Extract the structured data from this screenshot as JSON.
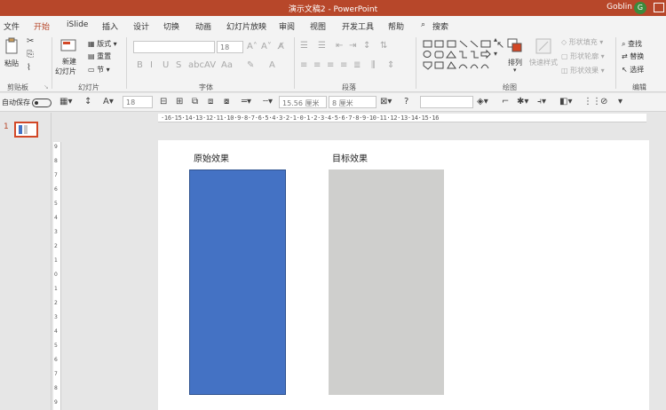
{
  "window": {
    "title": "演示文稿2 - PowerPoint",
    "user": "Goblin",
    "avatar_letter": "G"
  },
  "tabs": [
    "文件",
    "开始",
    "iSlide",
    "插入",
    "设计",
    "切换",
    "动画",
    "幻灯片放映",
    "审阅",
    "视图",
    "开发工具",
    "帮助",
    "搜索"
  ],
  "ribbon": {
    "clipboard": {
      "paste": "粘贴",
      "group": "剪贴板"
    },
    "slides": {
      "new_slide": "新建",
      "new_slide2": "幻灯片",
      "layout": "版式",
      "reset": "重置",
      "section": "节",
      "group": "幻灯片"
    },
    "font": {
      "font_name": "",
      "font_size": "18",
      "group": "字体"
    },
    "paragraph": {
      "group": "段落"
    },
    "drawing": {
      "arrange": "排列",
      "quick_styles": "快速样式",
      "shape_fill": "形状填充",
      "shape_outline": "形状轮廓",
      "shape_effects": "形状效果",
      "group": "绘图"
    },
    "editing": {
      "find": "查找",
      "replace": "替换",
      "select": "选择",
      "group": "编辑"
    }
  },
  "toolbar": {
    "autosave": "自动保存",
    "font_size": "18",
    "width": "15.56 厘米",
    "height": "8 厘米"
  },
  "ruler": {
    "horizontal": "·16·15·14·13·12·11·10·9·8·7·6·5·4·3·2·1·0·1·2·3·4·5·6·7·8·9·10·11·12·13·14·15·16",
    "vertical": [
      "9",
      "8",
      "7",
      "6",
      "5",
      "4",
      "3",
      "2",
      "1",
      "0",
      "1",
      "2",
      "3",
      "4",
      "5",
      "6",
      "7",
      "8",
      "9"
    ]
  },
  "thumbnails": {
    "slide_number": "1"
  },
  "slide": {
    "label_original": "原始效果",
    "label_target": "目标效果",
    "colors": {
      "original_bar": "#4472c4",
      "target_bar": "#cfcfcd"
    }
  }
}
